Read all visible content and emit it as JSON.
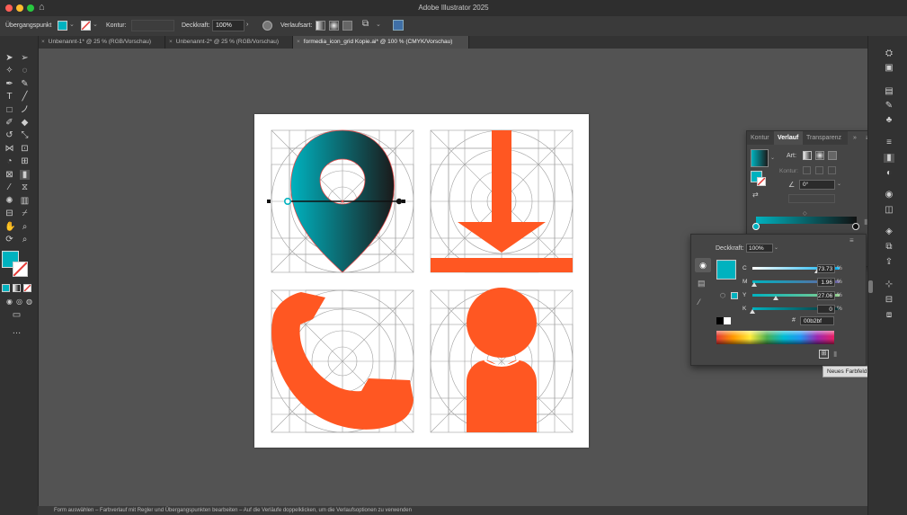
{
  "app": {
    "title": "Adobe Illustrator 2025"
  },
  "control_bar": {
    "mode_label": "Übergangspunkt",
    "stroke_label": "Kontur:",
    "opacity_label": "Deckkraft:",
    "opacity_value": "100%",
    "gradient_label": "Verlaufsart:"
  },
  "tabs": [
    {
      "label": "Unbenannt-1* @ 25 % (RGB/Vorschau)"
    },
    {
      "label": "Unbenannt-2* @ 25 % (RGB/Vorschau)"
    },
    {
      "label": "formedia_icon_grid Kopie.ai* @ 100 % (CMYK/Vorschau)"
    }
  ],
  "gradient_panel": {
    "tabs": [
      "Kontur",
      "Verlauf",
      "Transparenz"
    ],
    "type_label": "Art:",
    "stroke_label": "Kontur:",
    "angle_value": "0°"
  },
  "color_panel": {
    "opacity_label": "Deckkraft:",
    "opacity_value": "100%",
    "channels": [
      {
        "label": "C",
        "value": "73.73",
        "unit": "%",
        "level": 0.7373
      },
      {
        "label": "M",
        "value": "1.96",
        "unit": "%",
        "level": 0.0196
      },
      {
        "label": "Y",
        "value": "27.06",
        "unit": "%",
        "level": 0.2706
      },
      {
        "label": "K",
        "value": "0",
        "unit": "%",
        "level": 0
      }
    ],
    "hex_symbol": "#",
    "hex_value": "00b2bf"
  },
  "tooltip": "Neues Farbfeld",
  "status_bar": "Form auswählen – Farbverlauf mit Regler und Übergangspunkten bearbeiten – Auf die Verläufe doppelklicken, um die Verlaufsoptionen zu verwenden",
  "colors": {
    "accent": "#00b2bf",
    "icon_orange": "#ff5722",
    "gradient_dark": "#1a1a1a"
  }
}
